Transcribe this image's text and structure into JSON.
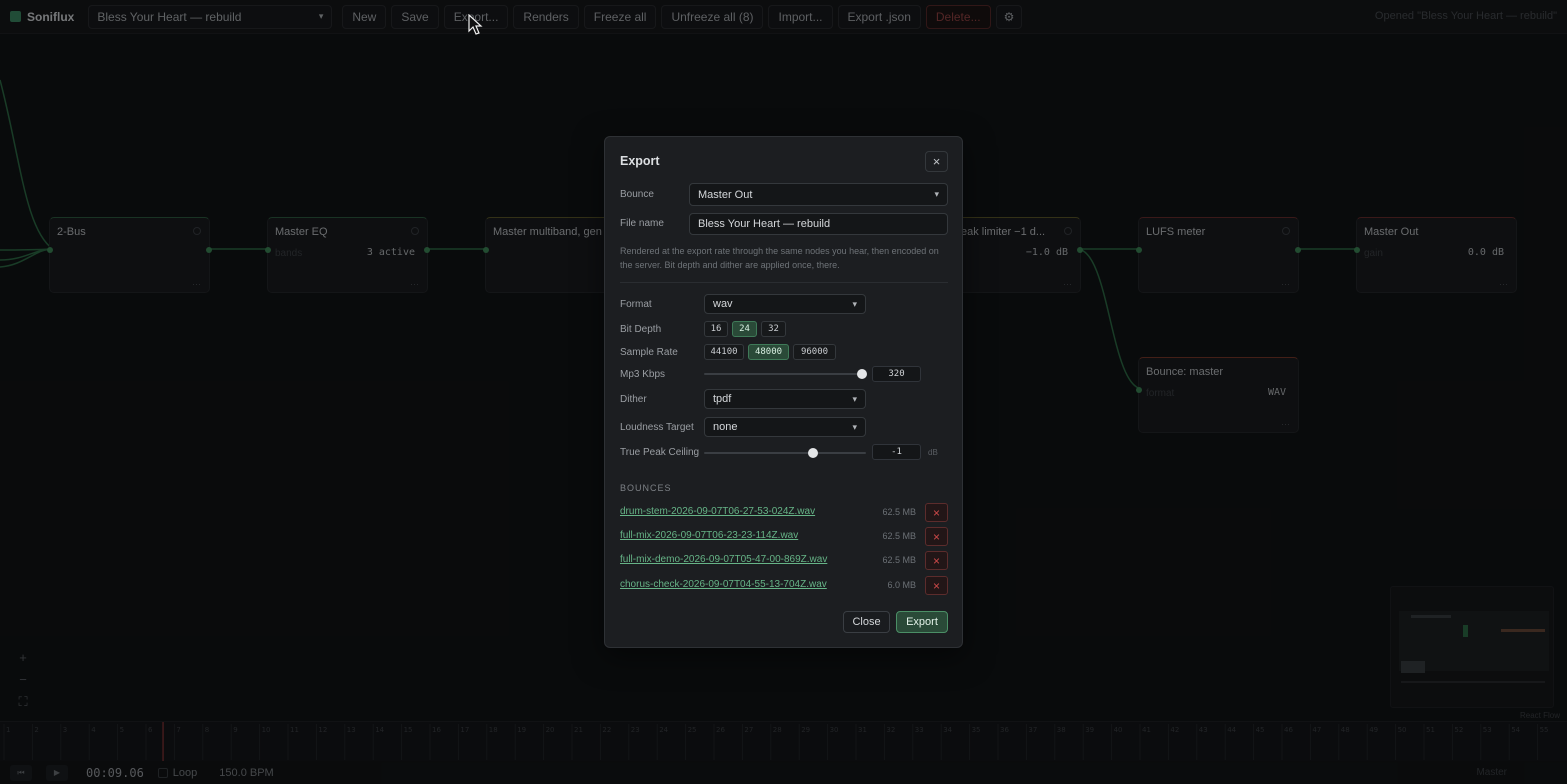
{
  "app": {
    "name": "Soniflux"
  },
  "toolbar": {
    "project": "Bless Your Heart — rebuild",
    "buttons": [
      "New",
      "Save",
      "Export...",
      "Renders",
      "Freeze all",
      "Unfreeze all (8)",
      "Import...",
      "Export .json",
      "Delete...",
      "⚙"
    ],
    "status": "Opened \"Bless Your Heart — rebuild\""
  },
  "nodes": [
    {
      "title": "2-Bus",
      "param": "",
      "value": ""
    },
    {
      "title": "Master EQ",
      "param": "bands",
      "value": "3 active"
    },
    {
      "title": "Master multiband, gen",
      "param": "",
      "value": ""
    },
    {
      "title": "eak limiter −1 d...",
      "param": "",
      "value": "−1.0 dB"
    },
    {
      "title": "LUFS meter",
      "param": "",
      "value": ""
    },
    {
      "title": "Master Out",
      "param": "gain",
      "value": "0.0 dB"
    },
    {
      "title": "Bounce: master",
      "param": "format",
      "value": "WAV"
    }
  ],
  "canvas": {
    "zoom_in": "+",
    "zoom_out": "−",
    "fit": "⛶",
    "attribution": "React Flow"
  },
  "timeline": {
    "time": "00:09.06",
    "loop_label": "Loop",
    "bpm": "150.0 BPM",
    "track_label": "Master",
    "ruler_start": 1,
    "ruler_end": 56,
    "playhead_bar": 6.6
  },
  "export_modal": {
    "title": "Export",
    "close_icon": "×",
    "bounce_label": "Bounce",
    "bounce_value": "Master Out",
    "filename_label": "File name",
    "filename_value": "Bless Your Heart — rebuild",
    "description": "Rendered at the export rate through the same nodes you hear, then encoded on the server. Bit depth and dither are applied once, there.",
    "format_label": "Format",
    "format_value": "wav",
    "bitdepth_label": "Bit Depth",
    "bitdepth_options": [
      "16",
      "24",
      "32"
    ],
    "bitdepth_selected": "24",
    "samplerate_label": "Sample Rate",
    "samplerate_options": [
      "44100",
      "48000",
      "96000"
    ],
    "samplerate_selected": "48000",
    "mp3_label": "Mp3 Kbps",
    "mp3_value": "320",
    "mp3_fraction": 1.0,
    "dither_label": "Dither",
    "dither_value": "tpdf",
    "loudness_label": "Loudness Target",
    "loudness_value": "none",
    "truepeak_label": "True Peak Ceiling",
    "truepeak_value": "-1",
    "truepeak_unit": "dB",
    "truepeak_fraction": 0.67,
    "bounces_heading": "BOUNCES",
    "bounces": [
      {
        "name": "drum-stem-2026-09-07T06-27-53-024Z.wav",
        "size": "62.5 MB"
      },
      {
        "name": "full-mix-2026-09-07T06-23-23-114Z.wav",
        "size": "62.5 MB"
      },
      {
        "name": "full-mix-demo-2026-09-07T05-47-00-869Z.wav",
        "size": "62.5 MB"
      },
      {
        "name": "chorus-check-2026-09-07T04-55-13-704Z.wav",
        "size": "6.0 MB"
      }
    ],
    "delete_icon": "×",
    "close_button": "Close",
    "export_button": "Export"
  }
}
